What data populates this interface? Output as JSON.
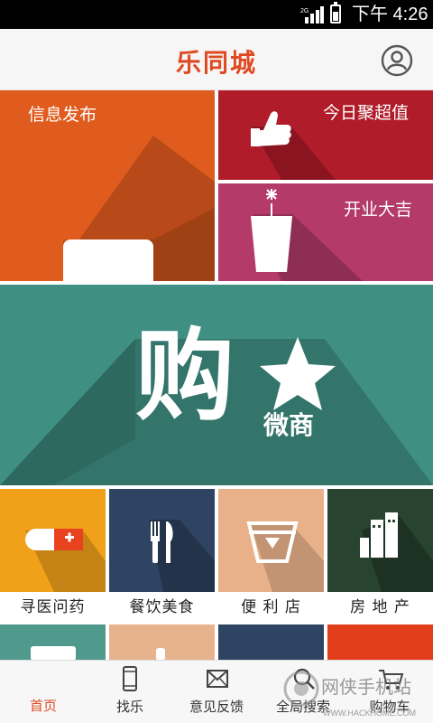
{
  "status_bar": {
    "network": "2G",
    "time": "下午 4:26"
  },
  "header": {
    "title": "乐同城",
    "user_icon": "user-icon"
  },
  "tiles": {
    "info": {
      "label": "信息发布",
      "color": "#e05b1e",
      "icon": "speech-bubble-icon"
    },
    "today": {
      "label": "今日聚超值",
      "color": "#b11c2a",
      "icon": "thumbs-up-icon"
    },
    "open": {
      "label": "开业大吉",
      "color": "#b33a69",
      "icon": "firecracker-icon"
    },
    "shop": {
      "big_char": "购",
      "sub_label": "微商",
      "color": "#3f8f82",
      "icon": "star-icon"
    }
  },
  "categories": [
    {
      "label": "寻医问药",
      "color": "#f0a019",
      "icon": "pill-icon"
    },
    {
      "label": "餐饮美食",
      "color": "#2f4462",
      "icon": "fork-knife-icon"
    },
    {
      "label": "便 利 店",
      "color": "#e8b189",
      "icon": "basket-icon"
    },
    {
      "label": "房 地 产",
      "color": "#28432f",
      "icon": "building-icon"
    }
  ],
  "bottom_nav": [
    {
      "label": "首页",
      "icon": "home-icon",
      "active": true
    },
    {
      "label": "找乐",
      "icon": "phone-icon",
      "active": false
    },
    {
      "label": "意见反馈",
      "icon": "mail-icon",
      "active": false
    },
    {
      "label": "全局搜索",
      "icon": "search-icon",
      "active": false
    },
    {
      "label": "购物车",
      "icon": "cart-icon",
      "active": false
    }
  ],
  "watermark": {
    "line1": "网侠手机站",
    "line2": "WWW.HACKHOME.COM"
  }
}
